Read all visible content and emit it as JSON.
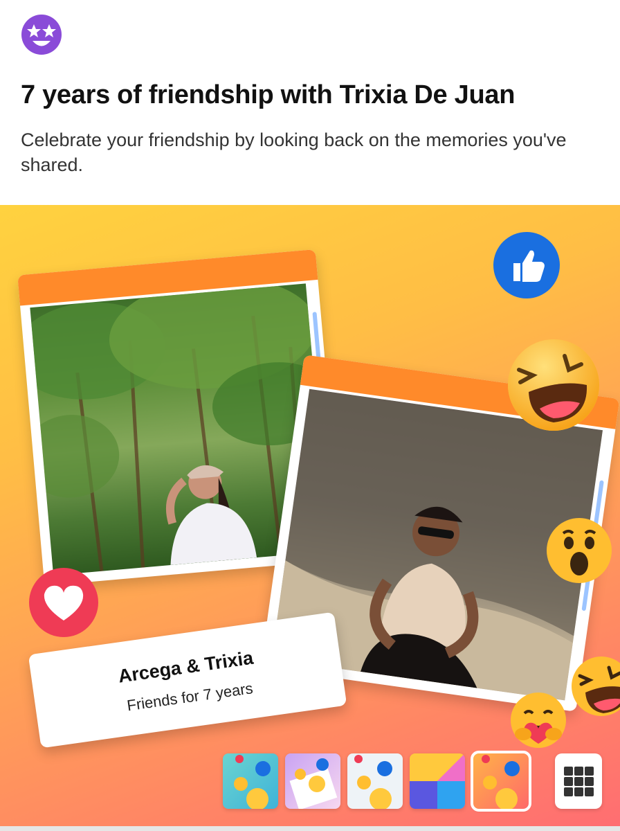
{
  "header": {
    "badge_icon": "star-eyes-emoji-icon",
    "title": "7 years of friendship with Trixia De Juan",
    "subtitle": "Celebrate your friendship by looking back on the memories you've shared."
  },
  "card": {
    "names": "Arcega & Trixia",
    "friends_for": "Friends for 7 years"
  },
  "reactions": [
    "like-icon",
    "haha-icon",
    "wow-icon",
    "love-icon",
    "care-icon",
    "haha-icon"
  ],
  "theme_picker": {
    "themes": [
      "theme-1",
      "theme-2",
      "theme-3",
      "theme-4",
      "theme-5"
    ],
    "selected_index": 4,
    "more_icon": "grid-icon"
  },
  "colors": {
    "accent_orange": "#ff8a2a",
    "like_blue": "#1a6fe0",
    "love_red": "#ef3b55",
    "badge_purple": "#8a4bd8"
  }
}
